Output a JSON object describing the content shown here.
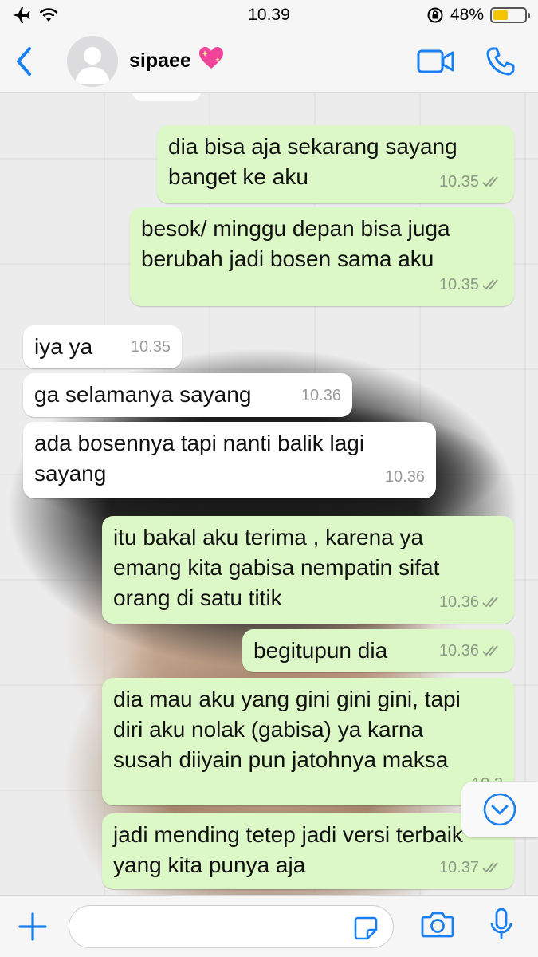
{
  "status_bar": {
    "time": "10.39",
    "battery_percent": "48%",
    "battery_level": 0.48,
    "battery_color": "#f5c400"
  },
  "header": {
    "contact_name": "sipaee",
    "name_emoji": "💖",
    "accent_color": "#1a7ff0"
  },
  "messages": [
    {
      "direction": "out",
      "text": "dia bisa aja sekarang sayang\nbanget ke aku",
      "time": "10.35",
      "ticks": "double-check"
    },
    {
      "direction": "out",
      "text": "besok/ minggu depan bisa juga\nberubah jadi bosen sama aku",
      "time": "10.35",
      "ticks": "double-check"
    },
    {
      "direction": "in",
      "text": "iya ya",
      "time": "10.35"
    },
    {
      "direction": "in",
      "text": "ga selamanya sayang",
      "time": "10.36"
    },
    {
      "direction": "in",
      "text": "ada bosennya tapi nanti balik lagi\nsayang",
      "time": "10.36"
    },
    {
      "direction": "out",
      "text": "itu bakal aku terima , karena ya\nemang kita gabisa nempatin sifat\norang di satu titik",
      "time": "10.36",
      "ticks": "double-check"
    },
    {
      "direction": "out",
      "text": "begitupun dia",
      "time": "10.36",
      "ticks": "double-check"
    },
    {
      "direction": "out",
      "text": "dia mau aku yang gini gini gini, tapi\ndiri aku nolak (gabisa) ya karna\nsusah diiyain pun jatohnya maksa",
      "time": "10.3",
      "ticks": ""
    },
    {
      "direction": "out",
      "text": "jadi mending tetep jadi versi terbaik\nyang kita punya aja",
      "time": "10.37",
      "ticks": "double-check"
    }
  ],
  "input": {
    "placeholder": ""
  },
  "icons": {
    "back": "chevron-left-icon",
    "video": "video-camera-icon",
    "call": "phone-icon",
    "plus": "plus-icon",
    "sticker": "sticker-icon",
    "camera": "camera-icon",
    "mic": "microphone-icon",
    "scroll": "chevron-down-circle-icon"
  }
}
